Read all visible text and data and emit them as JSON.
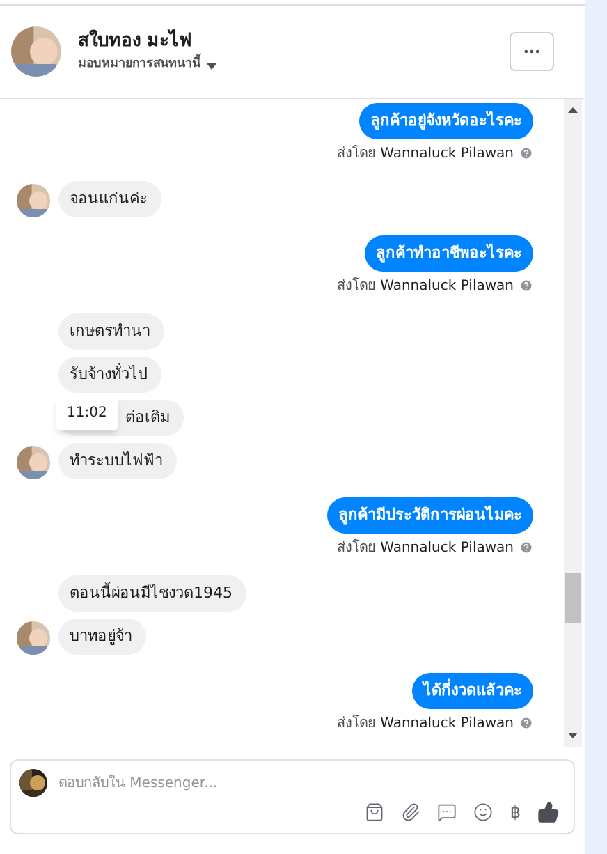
{
  "header": {
    "name": "สใบทอง มะไฟ",
    "assign_label": "มอบหมายการสนทนานี้"
  },
  "messages": [
    {
      "kind": "outgoing",
      "texts": [
        {
          "text": "ลูกค้าอยู่จังหวัดอะไรคะ"
        }
      ],
      "sent_by": "ส่งโดย",
      "sender": "Wannaluck Pilawan"
    },
    {
      "kind": "incoming",
      "texts": [
        {
          "text": "จอนแก่นค่ะ"
        }
      ]
    },
    {
      "kind": "outgoing",
      "texts": [
        {
          "text": "ลูกค้าทำอาชีพอะไรคะ"
        }
      ],
      "sent_by": "ส่งโดย",
      "sender": "Wannaluck Pilawan"
    },
    {
      "kind": "incoming",
      "texts": [
        {
          "text": "เกษตรทำนา"
        },
        {
          "text": "รับจ้างทั่วไป"
        },
        {
          "text": "ต่อเติม",
          "tooltip": "11:02"
        },
        {
          "text": "ทำระบบไฟฟ้า"
        }
      ]
    },
    {
      "kind": "outgoing",
      "texts": [
        {
          "text": "ลูกค้ามีประวัติการผ่อนไมคะ"
        }
      ],
      "sent_by": "ส่งโดย",
      "sender": "Wannaluck Pilawan"
    },
    {
      "kind": "incoming",
      "texts": [
        {
          "text": "ตอนนี้ผ่อนมีไชงวด1945"
        },
        {
          "text": "บาทอยู่จ้า"
        }
      ]
    },
    {
      "kind": "outgoing",
      "texts": [
        {
          "text": "ได้กี่งวดแล้วคะ"
        }
      ],
      "sent_by": "ส่งโดย",
      "sender": "Wannaluck Pilawan"
    }
  ],
  "composer": {
    "placeholder": "ตอบกลับใน Messenger...",
    "baht_symbol": "฿"
  }
}
